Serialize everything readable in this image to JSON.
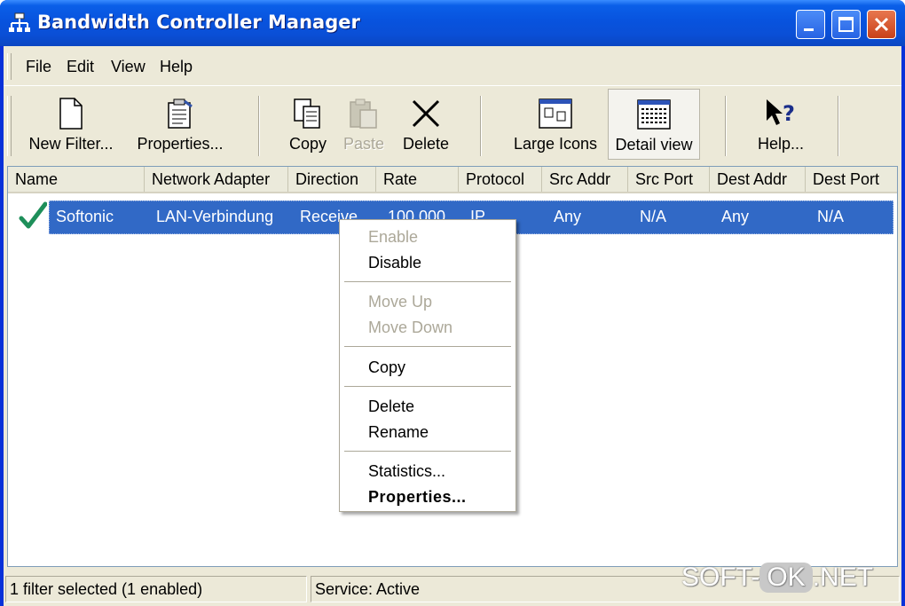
{
  "window": {
    "title": "Bandwidth Controller Manager"
  },
  "menu": {
    "items": [
      "File",
      "Edit",
      "View",
      "Help"
    ]
  },
  "toolbar": {
    "new_filter": "New Filter...",
    "properties": "Properties...",
    "copy": "Copy",
    "paste": "Paste",
    "delete": "Delete",
    "large_icons": "Large Icons",
    "detail_view": "Detail view",
    "help": "Help..."
  },
  "list": {
    "columns": [
      "Name",
      "Network Adapter",
      "Direction",
      "Rate",
      "Protocol",
      "Src Addr",
      "Src Port",
      "Dest Addr",
      "Dest Port"
    ],
    "rows": [
      {
        "enabled": true,
        "name": "Softonic",
        "adapter": "LAN-Verbindung",
        "direction": "Receive",
        "rate": "100,000",
        "protocol": "IP",
        "src_addr": "Any",
        "src_port": "N/A",
        "dest_addr": "Any",
        "dest_port": "N/A"
      }
    ]
  },
  "context_menu": {
    "enable": "Enable",
    "disable": "Disable",
    "move_up": "Move Up",
    "move_down": "Move Down",
    "copy": "Copy",
    "delete": "Delete",
    "rename": "Rename",
    "statistics": "Statistics...",
    "properties": "Properties..."
  },
  "status": {
    "selection": "1 filter selected (1 enabled)",
    "service": "Service: Active"
  },
  "watermark": {
    "left": "SOFT-",
    "ok": "OK",
    "right": ".NET"
  },
  "colors": {
    "titlebar": "#0853de",
    "selection": "#3169c6",
    "face": "#ece9d8",
    "check": "#1e8f5a"
  }
}
